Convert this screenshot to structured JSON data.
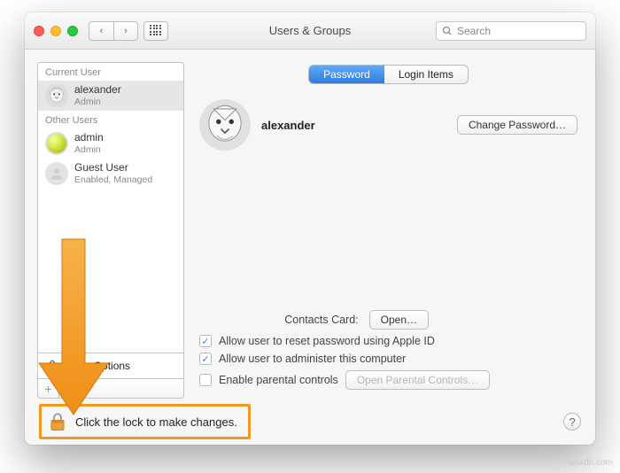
{
  "window": {
    "title": "Users & Groups"
  },
  "search": {
    "placeholder": "Search"
  },
  "sidebar": {
    "current_user_label": "Current User",
    "other_users_label": "Other Users",
    "current_user": {
      "name": "alexander",
      "role": "Admin"
    },
    "other_users": [
      {
        "name": "admin",
        "role": "Admin"
      },
      {
        "name": "Guest User",
        "role": "Enabled, Managed"
      }
    ],
    "login_options_label": "Login Options"
  },
  "tabs": {
    "password": "Password",
    "login_items": "Login Items"
  },
  "main": {
    "username": "alexander",
    "change_password_btn": "Change Password…",
    "contacts_label": "Contacts Card:",
    "open_btn": "Open…",
    "allow_reset": "Allow user to reset password using Apple ID",
    "allow_admin": "Allow user to administer this computer",
    "parental_label": "Enable parental controls",
    "parental_btn": "Open Parental Controls…"
  },
  "footer": {
    "lock_text": "Click the lock to make changes."
  },
  "watermark": "wsxdn.com",
  "colors": {
    "accent": "#f29a1f",
    "tab_active": "#3c8ce7"
  }
}
